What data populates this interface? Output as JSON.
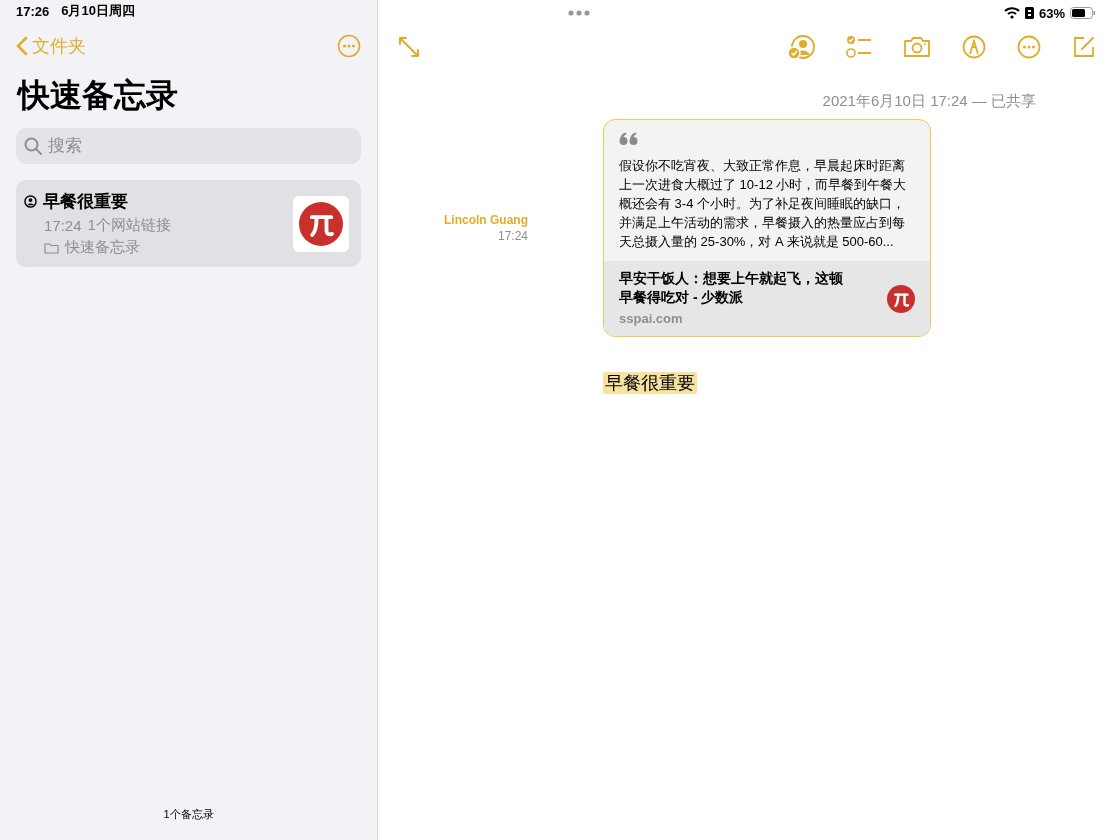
{
  "status_bar": {
    "time": "17:26",
    "date": "6月10日周四",
    "battery": "63%"
  },
  "sidebar": {
    "back_label": "文件夹",
    "title": "快速备忘录",
    "search": {
      "placeholder": "搜索"
    },
    "notes": [
      {
        "title": "早餐很重要",
        "time": "17:24",
        "summary": "1个网站链接",
        "folder": "快速备忘录",
        "shared": true,
        "selected": true
      }
    ],
    "footer": "1个备忘录"
  },
  "note": {
    "meta": "2021年6月10日 17:24 — 已共享",
    "author": "Lincoln Guang",
    "author_time": "17:24",
    "link_card": {
      "quote_lines": [
        "假设你不吃宵夜、大致正常作息，早晨起床时距离",
        "上一次进食大概过了 10-12 小时，而早餐到午餐大",
        "概还会有 3-4 个小时。为了补足夜间睡眠的缺口，",
        "并满足上午活动的需求，早餐摄入的热量应占到每",
        "天总摄入量的 25-30%，对 A 来说就是 500-60..."
      ],
      "title_lines": [
        "早安干饭人：想要上午就起飞，这顿",
        "早餐得吃对 - 少数派"
      ],
      "domain": "sspai.com"
    },
    "body": "早餐很重要",
    "highlighted": true
  }
}
